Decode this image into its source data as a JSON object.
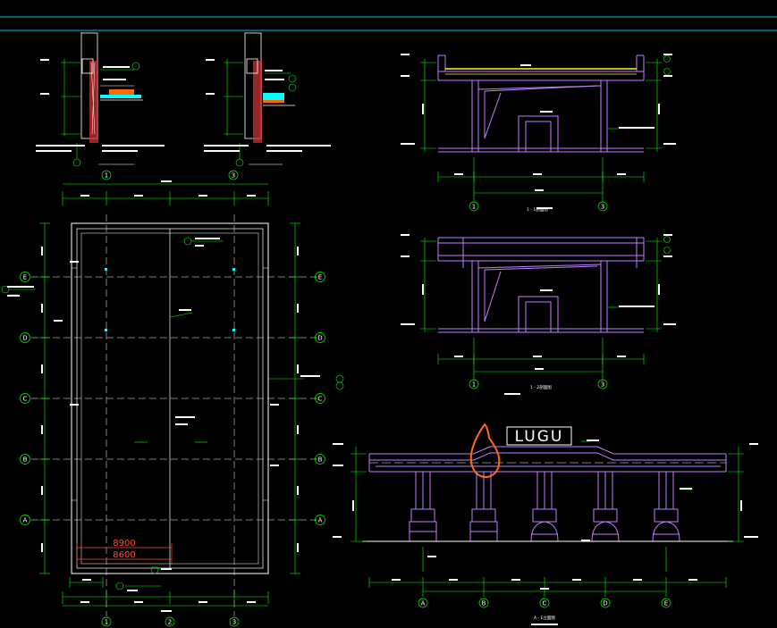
{
  "drawing": {
    "colors": {
      "background": "#000000",
      "frame_cyan": "#00bfe6",
      "dimension_green": "#00ff00",
      "structure_purple": "#c080ff",
      "beam_yellow": "#ffff00",
      "insulation_orange": "#ff6a00",
      "fill_cyan": "#00ffff",
      "wall_red": "#cc3333",
      "text_white": "#ffffff",
      "red_dim": "#ff4d2e",
      "flame_orange": "#ff6a1a"
    },
    "plan": {
      "row_axes": [
        "E",
        "D",
        "C",
        "B",
        "A"
      ],
      "col_axes": [
        "1",
        "2",
        "3"
      ],
      "red_dims": [
        "8900",
        "8600"
      ]
    },
    "section_1": {
      "axes": [
        "1",
        "3"
      ],
      "title": "1 - 1剖面图"
    },
    "section_2": {
      "axes": [
        "1",
        "3"
      ],
      "title": "1 - 2剖面图"
    },
    "elevation": {
      "logo": "LUGU",
      "axes": [
        "A",
        "B",
        "C",
        "D",
        "E"
      ],
      "title": "A - E立面图"
    },
    "details": {
      "axes_left": [
        "1"
      ],
      "axes_right": [
        "3"
      ]
    }
  }
}
